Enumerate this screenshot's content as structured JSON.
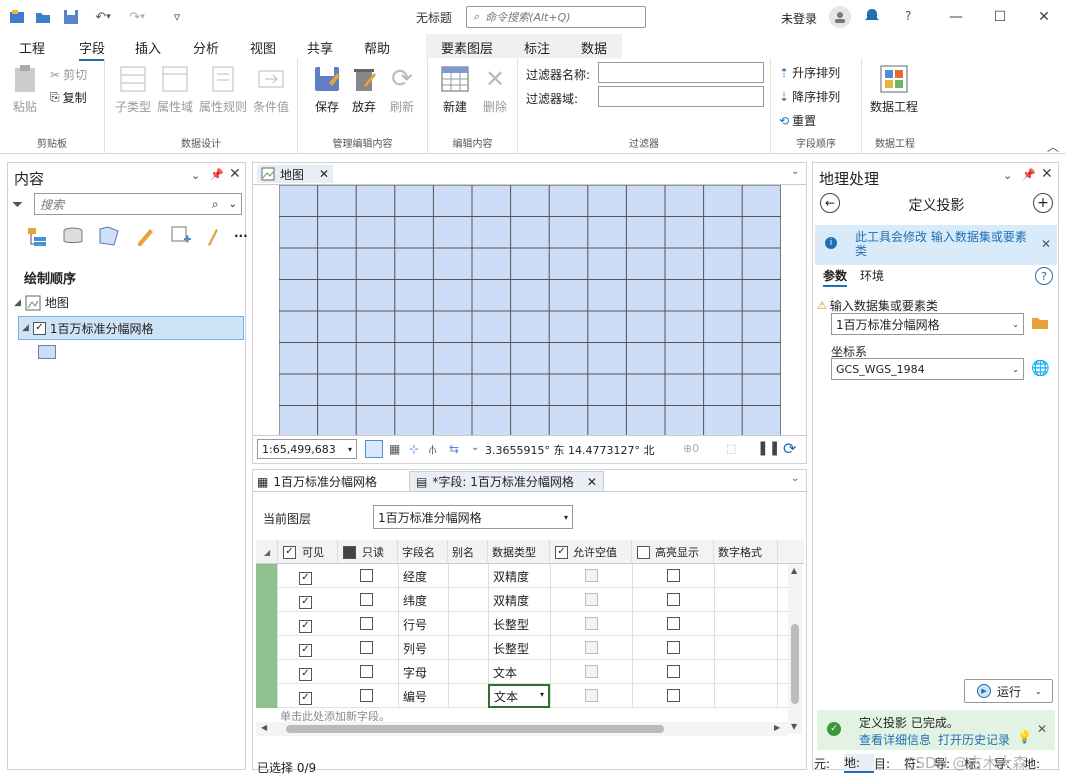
{
  "titlebar": {
    "doc_title": "无标题",
    "search_placeholder": "命令搜索(Alt+Q)",
    "login": "未登录"
  },
  "ribbon_tabs": [
    "工程",
    "字段",
    "插入",
    "分析",
    "视图",
    "共享",
    "帮助"
  ],
  "context_tabs": [
    "要素图层",
    "标注",
    "数据"
  ],
  "ribbon": {
    "clipboard": {
      "paste": "粘贴",
      "cut": "剪切",
      "copy": "复制",
      "label": "剪贴板"
    },
    "data_design": {
      "subtype": "子类型",
      "attr_domain": "属性域",
      "attr_rule": "属性规则",
      "condition": "条件值",
      "label": "数据设计"
    },
    "manage_edit": {
      "save": "保存",
      "discard": "放弃",
      "refresh": "刷新",
      "label": "管理编辑内容"
    },
    "edit": {
      "new": "新建",
      "delete": "删除",
      "label": "编辑内容"
    },
    "filter": {
      "name_label": "过滤器名称:",
      "domain_label": "过滤器域:",
      "label": "过滤器"
    },
    "field_order": {
      "asc": "升序排列",
      "desc": "降序排列",
      "reset": "重置",
      "label": "字段顺序"
    },
    "data_eng": {
      "btn": "数据工程",
      "label": "数据工程"
    }
  },
  "contents": {
    "title": "内容",
    "search_placeholder": "搜索",
    "draw_order": "绘制顺序",
    "map": "地图",
    "layer": "1百万标准分幅网格"
  },
  "map_tab": {
    "title": "地图",
    "scale": "1:65,499,683",
    "coords": "3.3655915° 东 14.4773127° 北",
    "sel_count": "0"
  },
  "bottom_tabs": {
    "tab1": "1百万标准分幅网格",
    "tab2": "*字段: 1百万标准分幅网格"
  },
  "fields": {
    "current_layer_label": "当前图层",
    "current_layer": "1百万标准分幅网格",
    "headers": [
      "可见",
      "只读",
      "字段名",
      "别名",
      "数据类型",
      "允许空值",
      "高亮显示",
      "数字格式"
    ],
    "rows": [
      {
        "name": "经度",
        "type": "双精度"
      },
      {
        "name": "纬度",
        "type": "双精度"
      },
      {
        "name": "行号",
        "type": "长整型"
      },
      {
        "name": "列号",
        "type": "长整型"
      },
      {
        "name": "字母",
        "type": "文本"
      },
      {
        "name": "编号",
        "type": "文本"
      }
    ],
    "add_hint": "单击此处添加新字段。",
    "selected": "已选择 0/9"
  },
  "geoprocessing": {
    "title": "地理处理",
    "tool_title": "定义投影",
    "info": "此工具会修改 输入数据集或要素类",
    "tab_params": "参数",
    "tab_env": "环境",
    "input_label": "输入数据集或要素类",
    "input_value": "1百万标准分幅网格",
    "crs_label": "坐标系",
    "crs_value": "GCS_WGS_1984",
    "run": "运行",
    "done": "定义投影 已完成。",
    "details": "查看详细信息",
    "history": "打开历史记录"
  },
  "bottom_status_tabs": [
    "元:",
    "地:",
    "目:",
    "符:",
    "导:",
    "标:",
    "导:",
    "地:"
  ],
  "watermark": "CSDN @古木大森"
}
